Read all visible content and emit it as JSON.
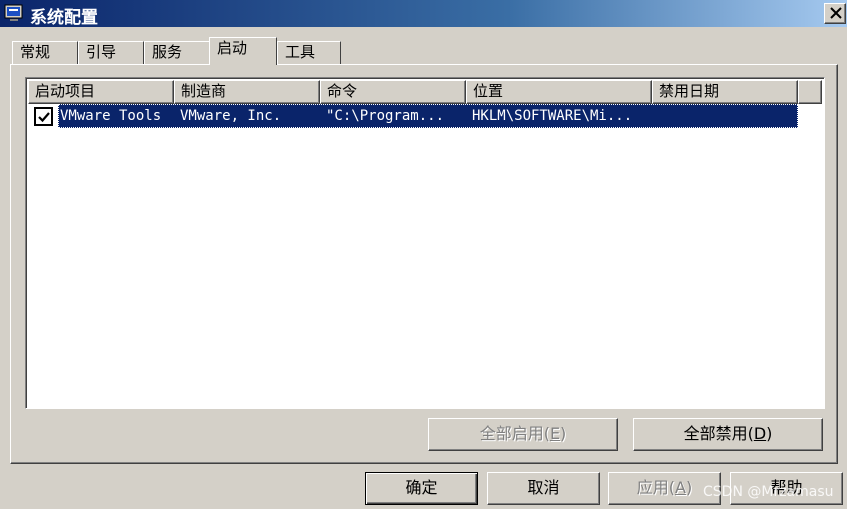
{
  "window": {
    "title": "系统配置",
    "icon": "system-config-icon",
    "close_icon": "close-icon"
  },
  "tabs": [
    {
      "label": "常规",
      "active": false
    },
    {
      "label": "引导",
      "active": false
    },
    {
      "label": "服务",
      "active": false
    },
    {
      "label": "启动",
      "active": true
    },
    {
      "label": "工具",
      "active": false
    }
  ],
  "startup_list": {
    "columns": [
      "启动项目",
      "制造商",
      "命令",
      "位置",
      "禁用日期"
    ],
    "rows": [
      {
        "checked": true,
        "selected": true,
        "item": "VMware Tools",
        "manufacturer": "VMware, Inc.",
        "command": "\"C:\\Program...",
        "location": "HKLM\\SOFTWARE\\Mi...",
        "disabled_date": ""
      }
    ]
  },
  "panel_buttons": {
    "enable_all": {
      "text": "全部启用(",
      "key": "E",
      "close": ")",
      "disabled": true
    },
    "disable_all": {
      "text": "全部禁用(",
      "key": "D",
      "close": ")",
      "disabled": false
    }
  },
  "dialog_buttons": {
    "ok": "确定",
    "cancel": "取消",
    "apply": {
      "text": "应用(",
      "key": "A",
      "close": ")",
      "disabled": true
    },
    "help": "帮助"
  },
  "watermark": "CSDN @Mrzamasu",
  "colors": {
    "face": "#d4d0c8",
    "selection": "#0a246a",
    "title_start": "#0a246a",
    "title_end": "#a6caf0"
  }
}
